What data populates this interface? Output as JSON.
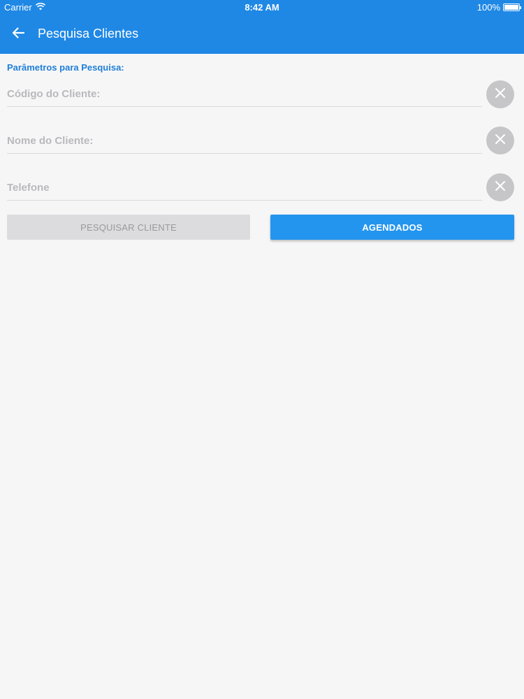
{
  "status_bar": {
    "carrier": "Carrier",
    "time": "8:42 AM",
    "battery": "100%",
    "battery_level": 1.0
  },
  "app_bar": {
    "title": "Pesquisa Clientes",
    "back_icon": "arrow-left-icon"
  },
  "form": {
    "section_label": "Parâmetros para Pesquisa:",
    "fields": [
      {
        "placeholder": "Código do Cliente:",
        "value": ""
      },
      {
        "placeholder": "Nome do Cliente:",
        "value": ""
      },
      {
        "placeholder": "Telefone",
        "value": ""
      }
    ],
    "clear_icon": "close-icon"
  },
  "buttons": {
    "search_label": "PESQUISAR CLIENTE",
    "scheduled_label": "AGENDADOS"
  },
  "colors": {
    "primary": "#1f88e5",
    "accent_button": "#2495ef",
    "disabled_button": "#dcdcde",
    "clear_circle": "#c6c6c8"
  }
}
